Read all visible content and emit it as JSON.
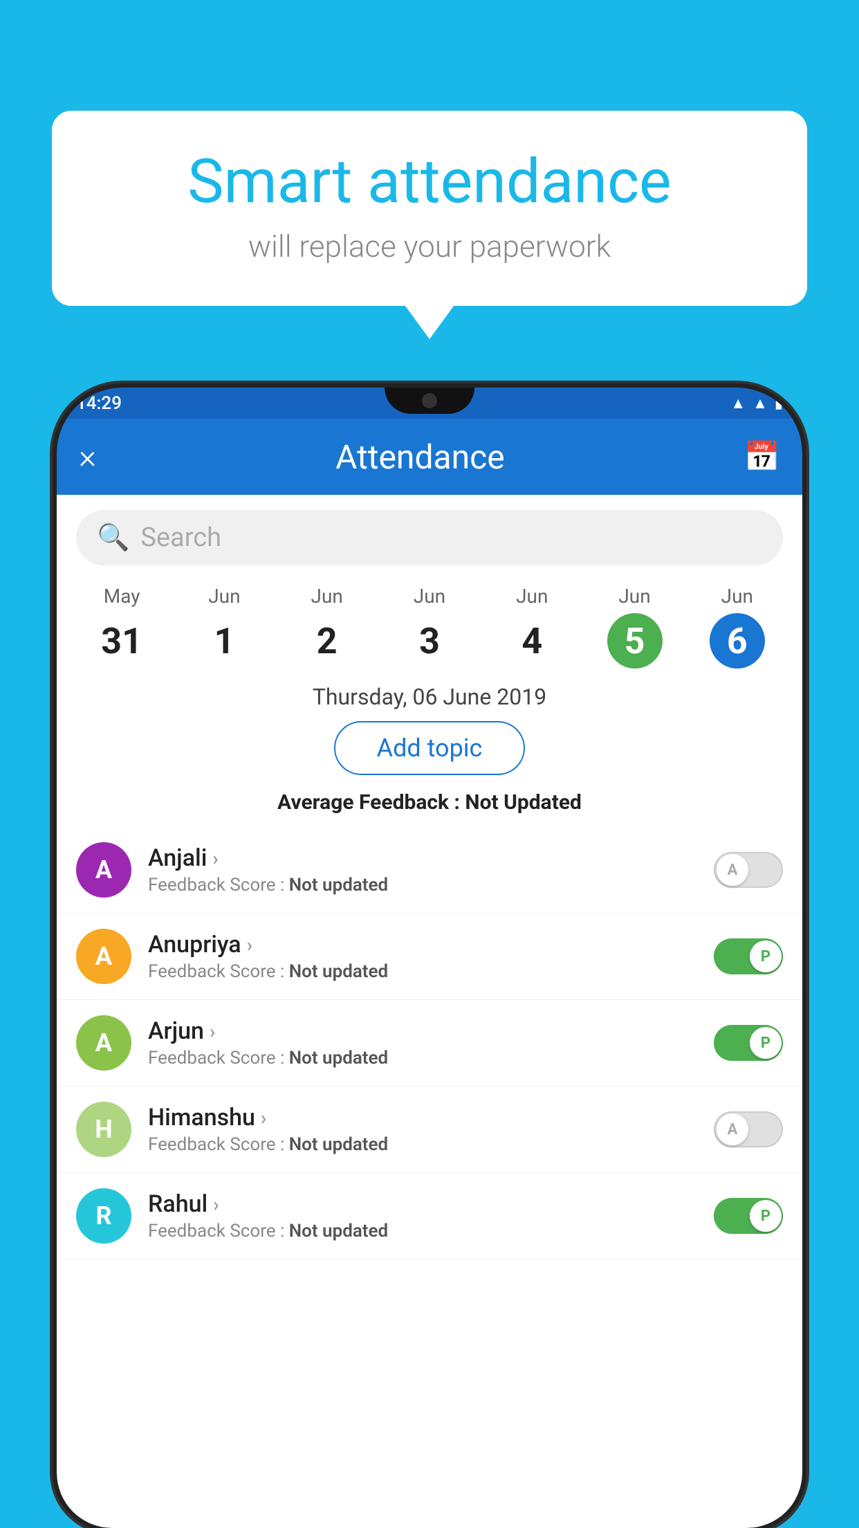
{
  "background_color": "#1ab8e8",
  "bubble": {
    "title": "Smart attendance",
    "subtitle": "will replace your paperwork"
  },
  "status_bar": {
    "time": "14:29",
    "icons": [
      "wifi",
      "signal",
      "battery"
    ]
  },
  "header": {
    "close_label": "×",
    "title": "Attendance",
    "calendar_icon": "📅"
  },
  "search": {
    "placeholder": "Search"
  },
  "dates": [
    {
      "month": "May",
      "day": "31",
      "style": "normal"
    },
    {
      "month": "Jun",
      "day": "1",
      "style": "normal"
    },
    {
      "month": "Jun",
      "day": "2",
      "style": "normal"
    },
    {
      "month": "Jun",
      "day": "3",
      "style": "normal"
    },
    {
      "month": "Jun",
      "day": "4",
      "style": "normal"
    },
    {
      "month": "Jun",
      "day": "5",
      "style": "today"
    },
    {
      "month": "Jun",
      "day": "6",
      "style": "selected"
    }
  ],
  "selected_date_label": "Thursday, 06 June 2019",
  "add_topic_label": "Add topic",
  "avg_feedback": {
    "prefix": "Average Feedback : ",
    "value": "Not Updated"
  },
  "students": [
    {
      "name": "Anjali",
      "avatar_letter": "A",
      "avatar_color": "#9c27b0",
      "feedback": "Feedback Score : ",
      "feedback_value": "Not updated",
      "toggle": "off",
      "toggle_letter": "A"
    },
    {
      "name": "Anupriya",
      "avatar_letter": "A",
      "avatar_color": "#f9a825",
      "feedback": "Feedback Score : ",
      "feedback_value": "Not updated",
      "toggle": "on",
      "toggle_letter": "P"
    },
    {
      "name": "Arjun",
      "avatar_letter": "A",
      "avatar_color": "#8bc34a",
      "feedback": "Feedback Score : ",
      "feedback_value": "Not updated",
      "toggle": "on",
      "toggle_letter": "P"
    },
    {
      "name": "Himanshu",
      "avatar_letter": "H",
      "avatar_color": "#aed581",
      "feedback": "Feedback Score : ",
      "feedback_value": "Not updated",
      "toggle": "off",
      "toggle_letter": "A"
    },
    {
      "name": "Rahul",
      "avatar_letter": "R",
      "avatar_color": "#26c6da",
      "feedback": "Feedback Score : ",
      "feedback_value": "Not updated",
      "toggle": "on",
      "toggle_letter": "P"
    }
  ]
}
